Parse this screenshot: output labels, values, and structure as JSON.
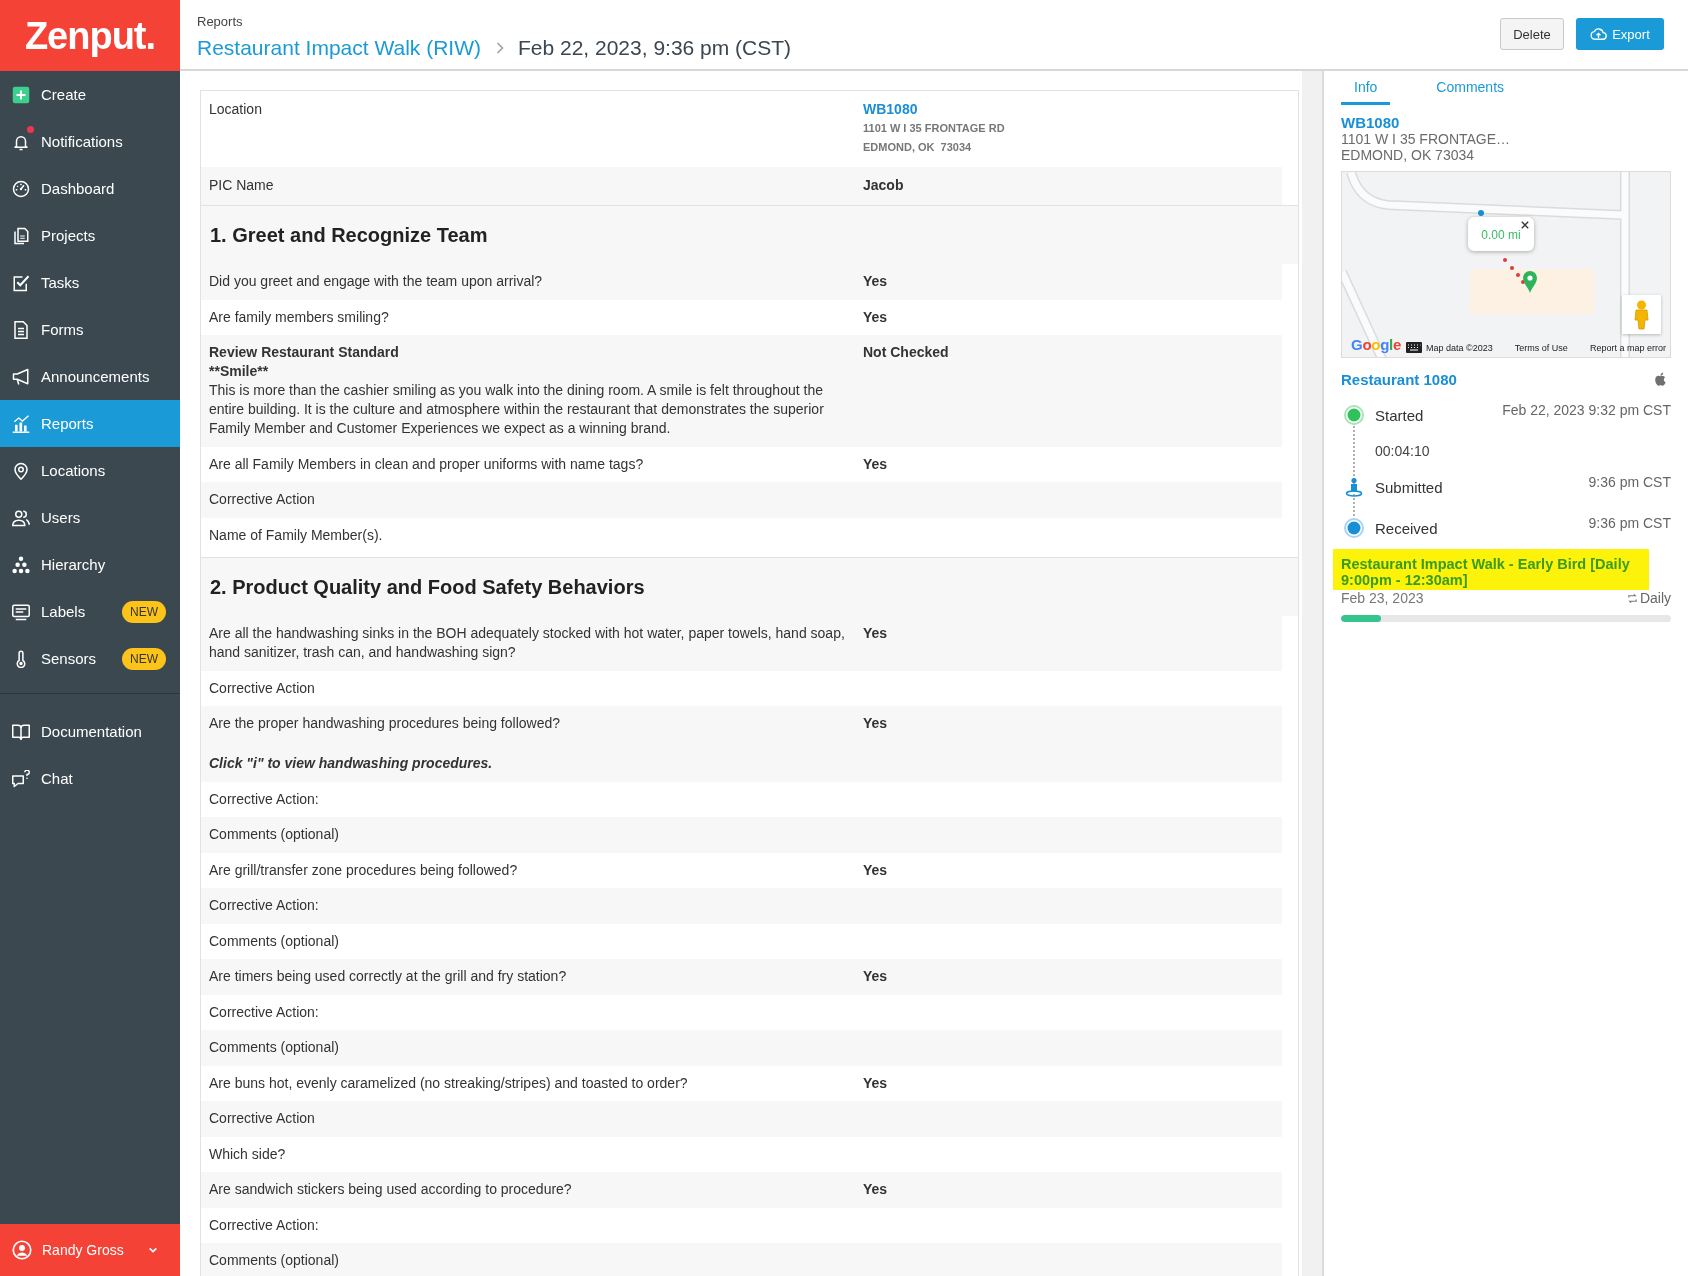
{
  "sidebar": {
    "logo": "Zenput.",
    "items": [
      {
        "label": "Create",
        "selected": false,
        "alert": false
      },
      {
        "label": "Notifications",
        "selected": false,
        "alert": true
      },
      {
        "label": "Dashboard",
        "selected": false,
        "alert": false
      },
      {
        "label": "Projects",
        "selected": false,
        "alert": false
      },
      {
        "label": "Tasks",
        "selected": false,
        "alert": false
      },
      {
        "label": "Forms",
        "selected": false,
        "alert": false
      },
      {
        "label": "Announcements",
        "selected": false,
        "alert": false
      },
      {
        "label": "Reports",
        "selected": true,
        "alert": false
      },
      {
        "label": "Locations",
        "selected": false,
        "alert": false
      },
      {
        "label": "Users",
        "selected": false,
        "alert": false
      },
      {
        "label": "Hierarchy",
        "selected": false,
        "alert": false
      },
      {
        "label": "Labels",
        "selected": false,
        "alert": false,
        "badge": "NEW"
      },
      {
        "label": "Sensors",
        "selected": false,
        "alert": false,
        "badge": "NEW"
      }
    ],
    "footer_items": [
      {
        "label": "Documentation",
        "selected": false
      },
      {
        "label": "Chat",
        "selected": false
      }
    ],
    "user": {
      "name": "Randy Gross"
    }
  },
  "header": {
    "breadcrumb": "Reports",
    "title": "Restaurant Impact Walk (RIW)",
    "subtitle": "Feb 22, 2023, 9:36 pm (CST)",
    "buttons": [
      {
        "kind": "secondary",
        "label": "Delete"
      },
      {
        "kind": "primary",
        "label": "Export"
      }
    ]
  },
  "report": {
    "details": [
      {
        "kind": "location",
        "label": "Location",
        "value": "WB1080",
        "address": [
          "1101 W I 35 FRONTAGE RD",
          "EDMOND, OK  73034"
        ]
      },
      {
        "kind": "text",
        "label": "PIC Name",
        "value": "Jacob"
      }
    ],
    "sections": [
      {
        "title": "1. Greet and Recognize Team",
        "items": [
          {
            "kind": "question",
            "text": "Did you greet and engage with the team upon arrival?",
            "answer": "Yes"
          },
          {
            "kind": "question",
            "text": "Are family members smiling?",
            "answer": "Yes"
          },
          {
            "kind": "standard",
            "title": "Review Restaurant Standard",
            "subtitle": "**Smile**",
            "text": "This is more than the cashier smiling as you walk into the dining room. A smile is felt throughout the entire building. It is the culture and atmosphere within the restaurant that demonstrates the superior Family Member and Customer Experiences we expect as a winning brand.",
            "answer": "Not Checked"
          },
          {
            "kind": "question",
            "text": "Are all Family Members in clean and proper uniforms with name tags?",
            "answer": "Yes"
          },
          {
            "kind": "question",
            "text": "Corrective Action"
          },
          {
            "kind": "question",
            "text": "Name of Family Member(s)."
          }
        ]
      },
      {
        "title": "2. Product Quality and Food Safety Behaviors",
        "items": [
          {
            "kind": "question",
            "text": "Are all the handwashing sinks in the BOH adequately stocked with hot water, paper towels, hand soap, hand sanitizer, trash can, and handwashing sign?",
            "answer": "Yes"
          },
          {
            "kind": "question",
            "text": "Corrective Action"
          },
          {
            "kind": "question",
            "text": "Are the proper handwashing procedures being followed?",
            "answer": "Yes",
            "note": "Click \"i\" to view handwashing procedures."
          },
          {
            "kind": "question",
            "text": "Corrective Action:"
          },
          {
            "kind": "question",
            "text": "Comments (optional)"
          },
          {
            "kind": "question",
            "text": "Are grill/transfer zone procedures being followed?",
            "answer": "Yes"
          },
          {
            "kind": "question",
            "text": "Corrective Action:"
          },
          {
            "kind": "question",
            "text": "Comments (optional)"
          },
          {
            "kind": "question",
            "text": "Are timers being used correctly at the grill and fry station?",
            "answer": "Yes"
          },
          {
            "kind": "question",
            "text": "Corrective Action:"
          },
          {
            "kind": "question",
            "text": "Comments (optional)"
          },
          {
            "kind": "question",
            "text": "Are buns hot, evenly caramelized (no streaking/stripes) and toasted to order?",
            "answer": "Yes"
          },
          {
            "kind": "question",
            "text": "Corrective Action"
          },
          {
            "kind": "question",
            "text": "Which side?"
          },
          {
            "kind": "question",
            "text": "Are sandwich stickers being used according to procedure?",
            "answer": "Yes"
          },
          {
            "kind": "question",
            "text": "Corrective Action:"
          },
          {
            "kind": "question",
            "text": "Comments (optional)"
          }
        ]
      }
    ]
  },
  "panel": {
    "tabs": [
      {
        "label": "Info",
        "selected": true
      },
      {
        "label": "Comments",
        "selected": false
      }
    ],
    "location": {
      "code": "WB1080",
      "address": [
        "1101 W I 35 FRONTAGE…",
        "EDMOND, OK 73034"
      ]
    },
    "map": {
      "distance": "0.00 mi",
      "logo": "Google",
      "attribution": "Map data ©2023",
      "links": [
        "Terms of Use",
        "Report a map error"
      ]
    },
    "store": "Restaurant 1080",
    "timeline": [
      {
        "kind": "started",
        "label": "Started",
        "time": "Feb 22, 2023 9:32 pm CST",
        "duration": "00:04:10"
      },
      {
        "kind": "submitted",
        "label": "Submitted",
        "time": "9:36 pm CST"
      },
      {
        "kind": "received",
        "label": "Received",
        "time": "9:36 pm CST"
      }
    ],
    "schedule": {
      "title": "Restaurant Impact Walk - Early Bird [Daily 9:00pm - 12:30am]",
      "highlighted": true,
      "date": "Feb 23, 2023",
      "frequency": "Daily",
      "level": 0.12
    }
  }
}
